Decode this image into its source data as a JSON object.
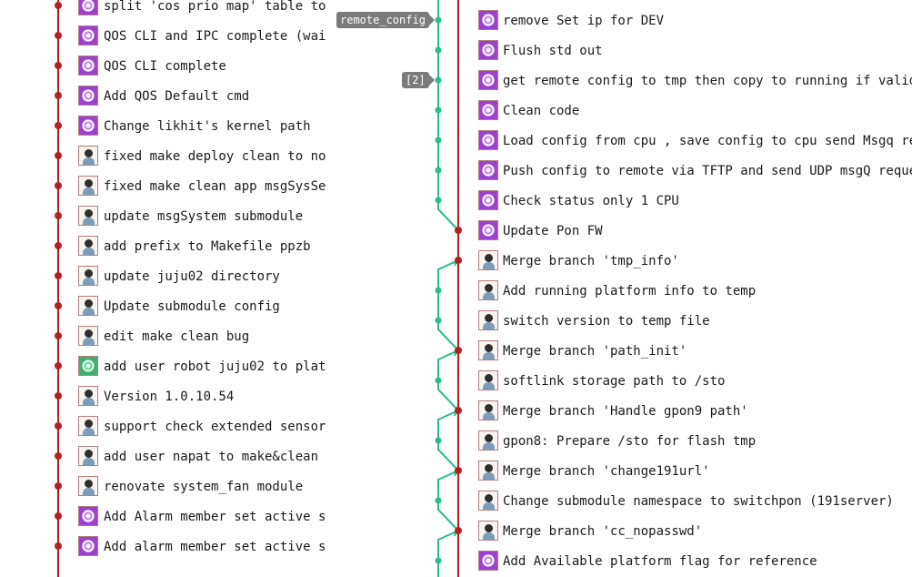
{
  "colors": {
    "main_branch": "#b32020",
    "side_branch": "#22c08a",
    "tag_bg": "#7b7b7b"
  },
  "left_column": {
    "commits": [
      {
        "message": "split 'cos prio map' table to",
        "avatar": "purple-identicon"
      },
      {
        "message": "QOS CLI and IPC complete (wai",
        "avatar": "purple-identicon"
      },
      {
        "message": "QOS CLI complete",
        "avatar": "purple-identicon"
      },
      {
        "message": "Add QOS Default cmd",
        "avatar": "purple-identicon"
      },
      {
        "message": "Change likhit's kernel path",
        "avatar": "purple-identicon"
      },
      {
        "message": "fixed make deploy clean to no",
        "avatar": "person-avatar"
      },
      {
        "message": "fixed make clean app msgSysSe",
        "avatar": "person-avatar"
      },
      {
        "message": "update msgSystem submodule",
        "avatar": "person-avatar"
      },
      {
        "message": "add prefix to Makefile ppzb",
        "avatar": "person-avatar"
      },
      {
        "message": "update juju02 directory",
        "avatar": "person-avatar"
      },
      {
        "message": "Update submodule config",
        "avatar": "person-avatar"
      },
      {
        "message": "edit make clean bug",
        "avatar": "person-avatar"
      },
      {
        "message": "add user robot juju02 to plat",
        "avatar": "green-identicon"
      },
      {
        "message": "Version 1.0.10.54",
        "avatar": "person-avatar"
      },
      {
        "message": "support check extended sensor",
        "avatar": "person-avatar"
      },
      {
        "message": "add user napat to make&clean",
        "avatar": "person-avatar"
      },
      {
        "message": "renovate system_fan module",
        "avatar": "person-avatar"
      },
      {
        "message": "Add Alarm member set active s",
        "avatar": "purple-identicon"
      },
      {
        "message": "Add alarm member set active s",
        "avatar": "purple-identicon"
      }
    ]
  },
  "right_column": {
    "tags": [
      {
        "label": "remote_config",
        "row": 0
      },
      {
        "label": "[2]",
        "row": 2
      }
    ],
    "commits": [
      {
        "message": "remove Set ip for DEV",
        "avatar": "purple-identicon",
        "lane": "side"
      },
      {
        "message": "Flush std out",
        "avatar": "purple-identicon",
        "lane": "side"
      },
      {
        "message": "get remote config to tmp then copy to running if valid",
        "avatar": "purple-identicon",
        "lane": "side"
      },
      {
        "message": "Clean code",
        "avatar": "purple-identicon",
        "lane": "side"
      },
      {
        "message": "Load config from cpu , save config to cpu send Msgq rep",
        "avatar": "purple-identicon",
        "lane": "side"
      },
      {
        "message": "Push config to remote via TFTP and send UDP msgQ reques",
        "avatar": "purple-identicon",
        "lane": "side"
      },
      {
        "message": "Check status only 1 CPU",
        "avatar": "purple-identicon",
        "lane": "side"
      },
      {
        "message": "Update Pon FW",
        "avatar": "purple-identicon",
        "lane": "main"
      },
      {
        "message": "Merge branch 'tmp_info'",
        "avatar": "person-avatar",
        "lane": "main"
      },
      {
        "message": "Add running platform info to temp",
        "avatar": "person-avatar",
        "lane": "side"
      },
      {
        "message": "switch version to temp file",
        "avatar": "person-avatar",
        "lane": "side"
      },
      {
        "message": "Merge branch 'path_init'",
        "avatar": "person-avatar",
        "lane": "main"
      },
      {
        "message": "softlink storage path to /sto",
        "avatar": "person-avatar",
        "lane": "side"
      },
      {
        "message": "Merge branch 'Handle gpon9 path'",
        "avatar": "person-avatar",
        "lane": "main"
      },
      {
        "message": "gpon8: Prepare /sto for flash tmp",
        "avatar": "person-avatar",
        "lane": "side"
      },
      {
        "message": "Merge branch 'change191url'",
        "avatar": "person-avatar",
        "lane": "main"
      },
      {
        "message": "Change submodule namespace to switchpon (191server)",
        "avatar": "person-avatar",
        "lane": "side"
      },
      {
        "message": "Merge branch 'cc_nopasswd'",
        "avatar": "person-avatar",
        "lane": "main"
      },
      {
        "message": "Add Available platform flag for reference",
        "avatar": "purple-identicon",
        "lane": "side"
      }
    ]
  }
}
